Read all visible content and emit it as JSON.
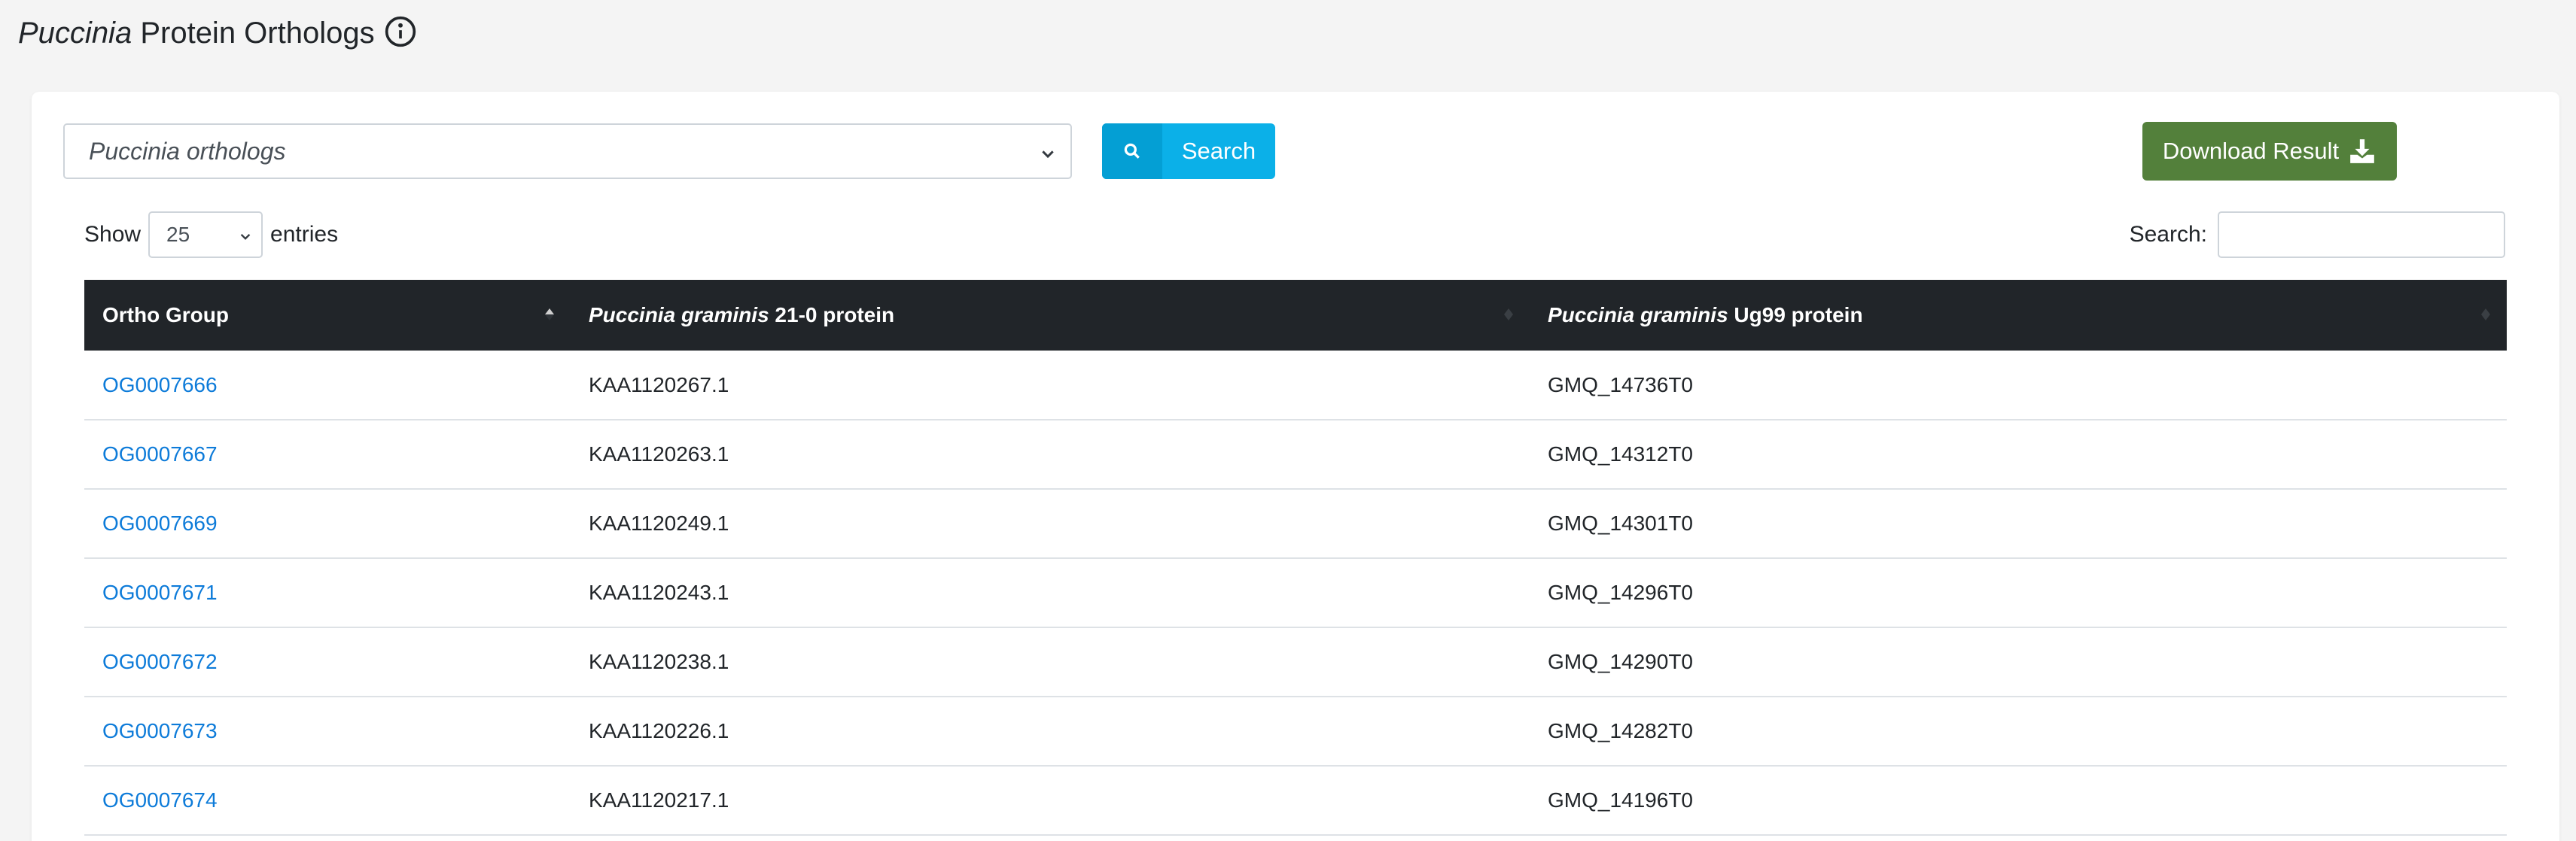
{
  "header": {
    "title_italic": "Puccinia",
    "title_rest": "Protein Orthologs",
    "info_icon": "info-circle-icon"
  },
  "toolbar": {
    "dataset_select": "Puccinia orthologs",
    "search_label": "Search",
    "search_icon": "magnifier-icon",
    "download_label": "Download Result",
    "download_icon": "download-icon"
  },
  "table_controls": {
    "show_label": "Show",
    "page_length": "25",
    "entries_label": "entries",
    "filter_label": "Search:",
    "filter_value": ""
  },
  "table": {
    "columns": [
      {
        "label": "Ortho Group"
      },
      {
        "italic": "Puccinia graminis",
        "rest": "21-0 protein"
      },
      {
        "italic": "Puccinia graminis",
        "rest": "Ug99 protein"
      }
    ],
    "rows": [
      {
        "group": "OG0007666",
        "p21": "KAA1120267.1",
        "ug99": "GMQ_14736T0"
      },
      {
        "group": "OG0007667",
        "p21": "KAA1120263.1",
        "ug99": "GMQ_14312T0"
      },
      {
        "group": "OG0007669",
        "p21": "KAA1120249.1",
        "ug99": "GMQ_14301T0"
      },
      {
        "group": "OG0007671",
        "p21": "KAA1120243.1",
        "ug99": "GMQ_14296T0"
      },
      {
        "group": "OG0007672",
        "p21": "KAA1120238.1",
        "ug99": "GMQ_14290T0"
      },
      {
        "group": "OG0007673",
        "p21": "KAA1120226.1",
        "ug99": "GMQ_14282T0"
      },
      {
        "group": "OG0007674",
        "p21": "KAA1120217.1",
        "ug99": "GMQ_14196T0"
      }
    ]
  },
  "colors": {
    "search_button": "#0bb0e8",
    "download_button": "#53803b",
    "table_header": "#212529",
    "link": "#0d7bd9"
  }
}
